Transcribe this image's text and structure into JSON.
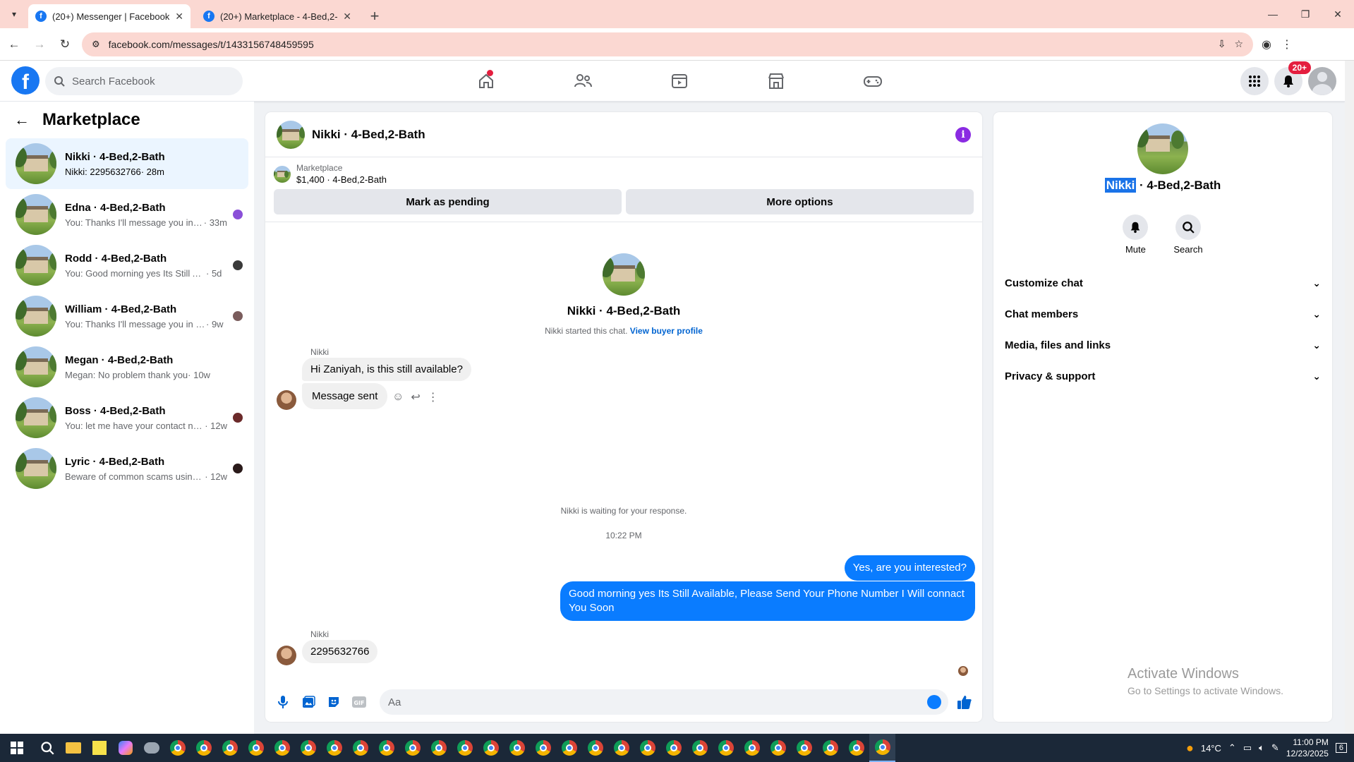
{
  "browser": {
    "tabs": [
      {
        "title": "(20+) Messenger | Facebook",
        "active": true
      },
      {
        "title": "(20+) Marketplace - 4-Bed,2-Ba",
        "active": false
      }
    ],
    "url": "facebook.com/messages/t/1433156748459595"
  },
  "fbnav": {
    "search_placeholder": "Search Facebook",
    "notif_badge": "20+"
  },
  "sidebar": {
    "title": "Marketplace",
    "conversations": [
      {
        "name": "Nikki · 4-Bed,2-Bath",
        "snippet": "Nikki: 2295632766",
        "time": " · 28m",
        "active": true,
        "seen_color": ""
      },
      {
        "name": "Edna · 4-Bed,2-Bath",
        "snippet": "You: Thanks I'll message you in a ...",
        "time": " · 33m",
        "active": false,
        "seen_color": "#8a4fd8"
      },
      {
        "name": "Rodd · 4-Bed,2-Bath",
        "snippet": "You: Good morning yes Its Still Avai...",
        "time": " · 5d",
        "active": false,
        "seen_color": "#3a3a3a"
      },
      {
        "name": "William · 4-Bed,2-Bath",
        "snippet": "You: Thanks I'll message you in a ...",
        "time": " · 9w",
        "active": false,
        "seen_color": "#7a5c5c"
      },
      {
        "name": "Megan · 4-Bed,2-Bath",
        "snippet": "Megan: No problem thank you",
        "time": " · 10w",
        "active": false,
        "seen_color": ""
      },
      {
        "name": "Boss · 4-Bed,2-Bath",
        "snippet": "You: let me have your contact nu...",
        "time": " · 12w",
        "active": false,
        "seen_color": "#6b2a2a"
      },
      {
        "name": "Lyric · 4-Bed,2-Bath",
        "snippet": "Beware of common scams using ...",
        "time": " · 12w",
        "active": false,
        "seen_color": "#2a1a1a"
      }
    ]
  },
  "chat": {
    "header_name": "Nikki · 4-Bed,2-Bath",
    "listing_label": "Marketplace",
    "listing_price": "$1,400 · 4-Bed,2-Bath",
    "btn_pending": "Mark as pending",
    "btn_more": "More options",
    "intro_name": "Nikki · 4-Bed,2-Bath",
    "started_text": "Nikki started this chat. ",
    "view_profile": "View buyer profile",
    "sender1": "Nikki",
    "msg1": "Hi Zaniyah, is this still available?",
    "msg2": "Message sent",
    "waiting": "Nikki is waiting for your response.",
    "timestamp": "10:22 PM",
    "out1": "Yes, are you interested?",
    "out2": "Good morning yes  Its Still Available, Please Send Your Phone Number I Will connact You Soon",
    "sender2": "Nikki",
    "msg3": "2295632766",
    "composer_placeholder": "Aa"
  },
  "details": {
    "name_highlight": "Nikki",
    "name_rest": " · 4-Bed,2-Bath",
    "mute": "Mute",
    "search": "Search",
    "menu": [
      "Customize chat",
      "Chat members",
      "Media, files and links",
      "Privacy & support"
    ]
  },
  "watermark": {
    "line1": "Activate Windows",
    "line2": "Go to Settings to activate Windows."
  },
  "taskbar": {
    "weather": "14°C",
    "time": "11:00 PM",
    "date": "12/23/2025",
    "notif_count": "6"
  }
}
